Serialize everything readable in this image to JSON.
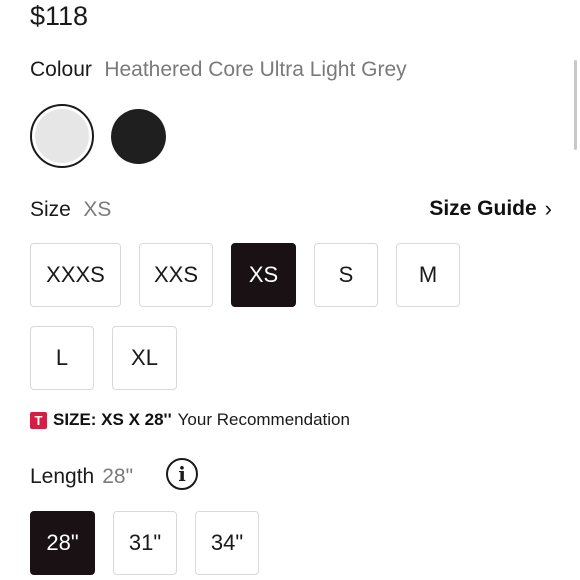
{
  "price": "$118",
  "colour": {
    "label": "Colour",
    "selected_name": "Heathered Core Ultra Light Grey",
    "swatches": [
      {
        "name": "Heathered Core Ultra Light Grey",
        "color": "#e6e6e6",
        "selected": true
      },
      {
        "name": "Black",
        "color": "#1f1f1f",
        "selected": false
      }
    ]
  },
  "size": {
    "label": "Size",
    "selected": "XS",
    "guide_label": "Size Guide",
    "options": [
      "XXXS",
      "XXS",
      "XS",
      "S",
      "M",
      "L",
      "XL"
    ]
  },
  "recommendation": {
    "badge": "T",
    "strong": "SIZE: XS X 28''",
    "text": "Your Recommendation"
  },
  "length": {
    "label": "Length",
    "selected": "28\"",
    "info_glyph": "i",
    "options": [
      "28\"",
      "31\"",
      "34\""
    ]
  },
  "colors": {
    "selected_bg": "#191113",
    "badge": "#d31f43",
    "border": "#d9d9d9"
  }
}
